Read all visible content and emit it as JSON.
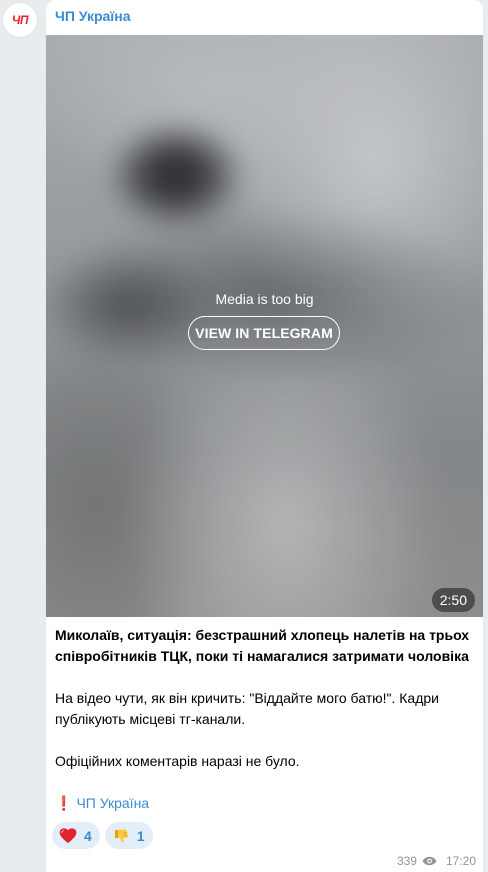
{
  "channel": {
    "avatar_text": "ЧП",
    "name": "ЧП Україна"
  },
  "media": {
    "message": "Media is too big",
    "button_label": "VIEW IN TELEGRAM",
    "duration": "2:50"
  },
  "post": {
    "headline": "Миколаїв, ситуація: безстрашний хлопець налетів на трьох співробітників ТЦК, поки ті намагалися затримати чоловіка",
    "paragraph1": "На відео чути, як він кричить: \"Віддайте мого батю!\". Кадри публікують місцеві тг-канали.",
    "paragraph2": "Офіційних коментарів наразі не було.",
    "signature_mark": "❗",
    "signature_link": "ЧП Україна",
    "signature_flag": "ukraine-flag"
  },
  "reactions": [
    {
      "emoji": "heart",
      "count": "4"
    },
    {
      "emoji": "thumbs-down",
      "count": "1"
    }
  ],
  "meta": {
    "views": "339",
    "time": "17:20"
  },
  "colors": {
    "accent": "#3a8bd0",
    "background": "#e8ecef",
    "reaction_bg": "#e3eef9",
    "meta_text": "#8d969c"
  }
}
